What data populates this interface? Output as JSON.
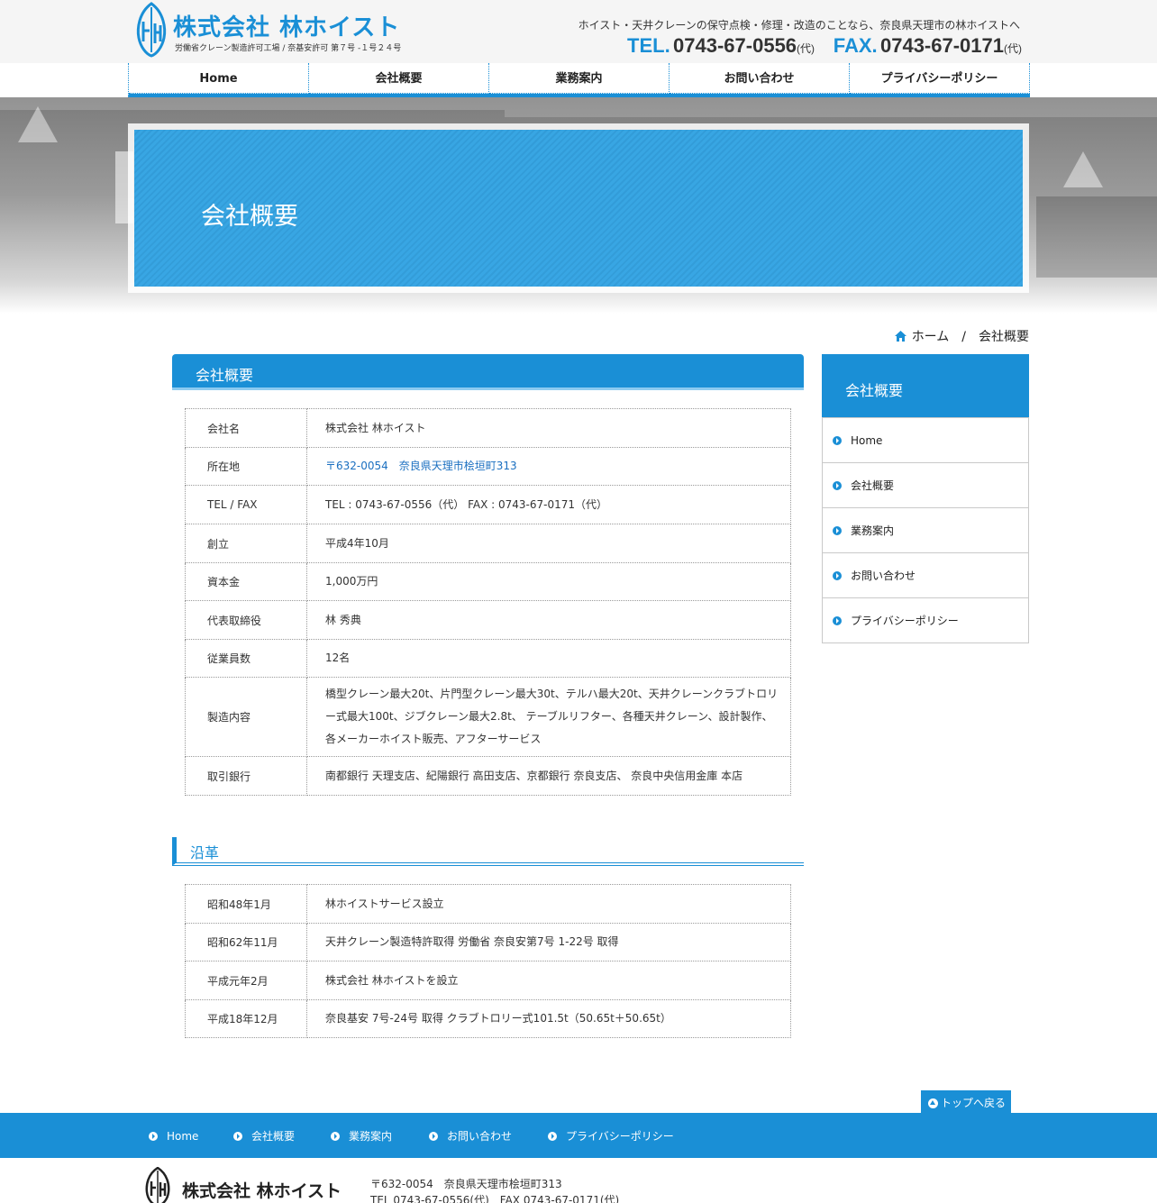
{
  "header": {
    "company_name": "株式会社 林ホイスト",
    "license_text": "労働省クレーン製造許可工場 / 奈基安許可 第７号 -１号２４号",
    "tagline": "ホイスト・天井クレーンの保守点検・修理・改造のことなら、奈良県天理市の林ホイストへ",
    "tel_label": "TEL.",
    "tel_number": "0743-67-0556",
    "tel_suffix": "(代)",
    "fax_label": "FAX.",
    "fax_number": "0743-67-0171",
    "fax_suffix": "(代)"
  },
  "nav": [
    "Home",
    "会社概要",
    "業務案内",
    "お問い合わせ",
    "プライバシーポリシー"
  ],
  "hero": {
    "title": "会社概要"
  },
  "breadcrumb": {
    "home": "ホーム",
    "separator": "/",
    "current": "会社概要"
  },
  "company": {
    "heading": "会社概要",
    "rows": [
      {
        "label": "会社名",
        "value": "株式会社 林ホイスト"
      },
      {
        "label": "所在地",
        "value": "〒632-0054　奈良県天理市桧垣町313"
      },
      {
        "label": "TEL / FAX",
        "value": "TEL : 0743-67-0556（代）  FAX : 0743-67-0171（代）"
      },
      {
        "label": "創立",
        "value": "平成4年10月"
      },
      {
        "label": "資本金",
        "value": "1,000万円"
      },
      {
        "label": "代表取締役",
        "value": "林 秀典"
      },
      {
        "label": "従業員数",
        "value": "12名"
      },
      {
        "label": "製造内容",
        "value": "橋型クレーン最大20t、片門型クレーン最大30t、テルハ最大20t、天井クレーンクラブトロリー式最大100t、ジブクレーン最大2.8t、 テーブルリフター、各種天井クレーン、設計製作、 各メーカーホイスト販売、アフターサービス"
      },
      {
        "label": "取引銀行",
        "value": "南都銀行 天理支店、紀陽銀行 高田支店、京都銀行 奈良支店、 奈良中央信用金庫 本店"
      }
    ]
  },
  "history": {
    "heading": "沿革",
    "rows": [
      {
        "label": "昭和48年1月",
        "value": "林ホイストサービス設立"
      },
      {
        "label": "昭和62年11月",
        "value": "天井クレーン製造特許取得 労働省 奈良安第7号 1-22号 取得"
      },
      {
        "label": "平成元年2月",
        "value": "株式会社 林ホイストを設立"
      },
      {
        "label": "平成18年12月",
        "value": "奈良基安 7号-24号 取得 クラブトロリー式101.5t（50.65t＋50.65t）"
      }
    ]
  },
  "sidebar": {
    "heading": "会社概要",
    "items": [
      "Home",
      "会社概要",
      "業務案内",
      "お問い合わせ",
      "プライバシーポリシー"
    ]
  },
  "to_top": "トップへ戻る",
  "footer_nav": [
    "Home",
    "会社概要",
    "業務案内",
    "お問い合わせ",
    "プライバシーポリシー"
  ],
  "footer": {
    "company_name": "株式会社 林ホイスト",
    "address": "〒632-0054　奈良県天理市桧垣町313",
    "tel_fax": "TEL 0743-67-0556(代)　FAX 0743-67-0171(代)"
  },
  "colors": {
    "brand_blue": "#1a8fd6",
    "link_blue": "#1a6fc0"
  },
  "icons": [
    "hoist-logo-icon",
    "home-icon",
    "circle-arrow-icon",
    "arrow-up-icon"
  ]
}
